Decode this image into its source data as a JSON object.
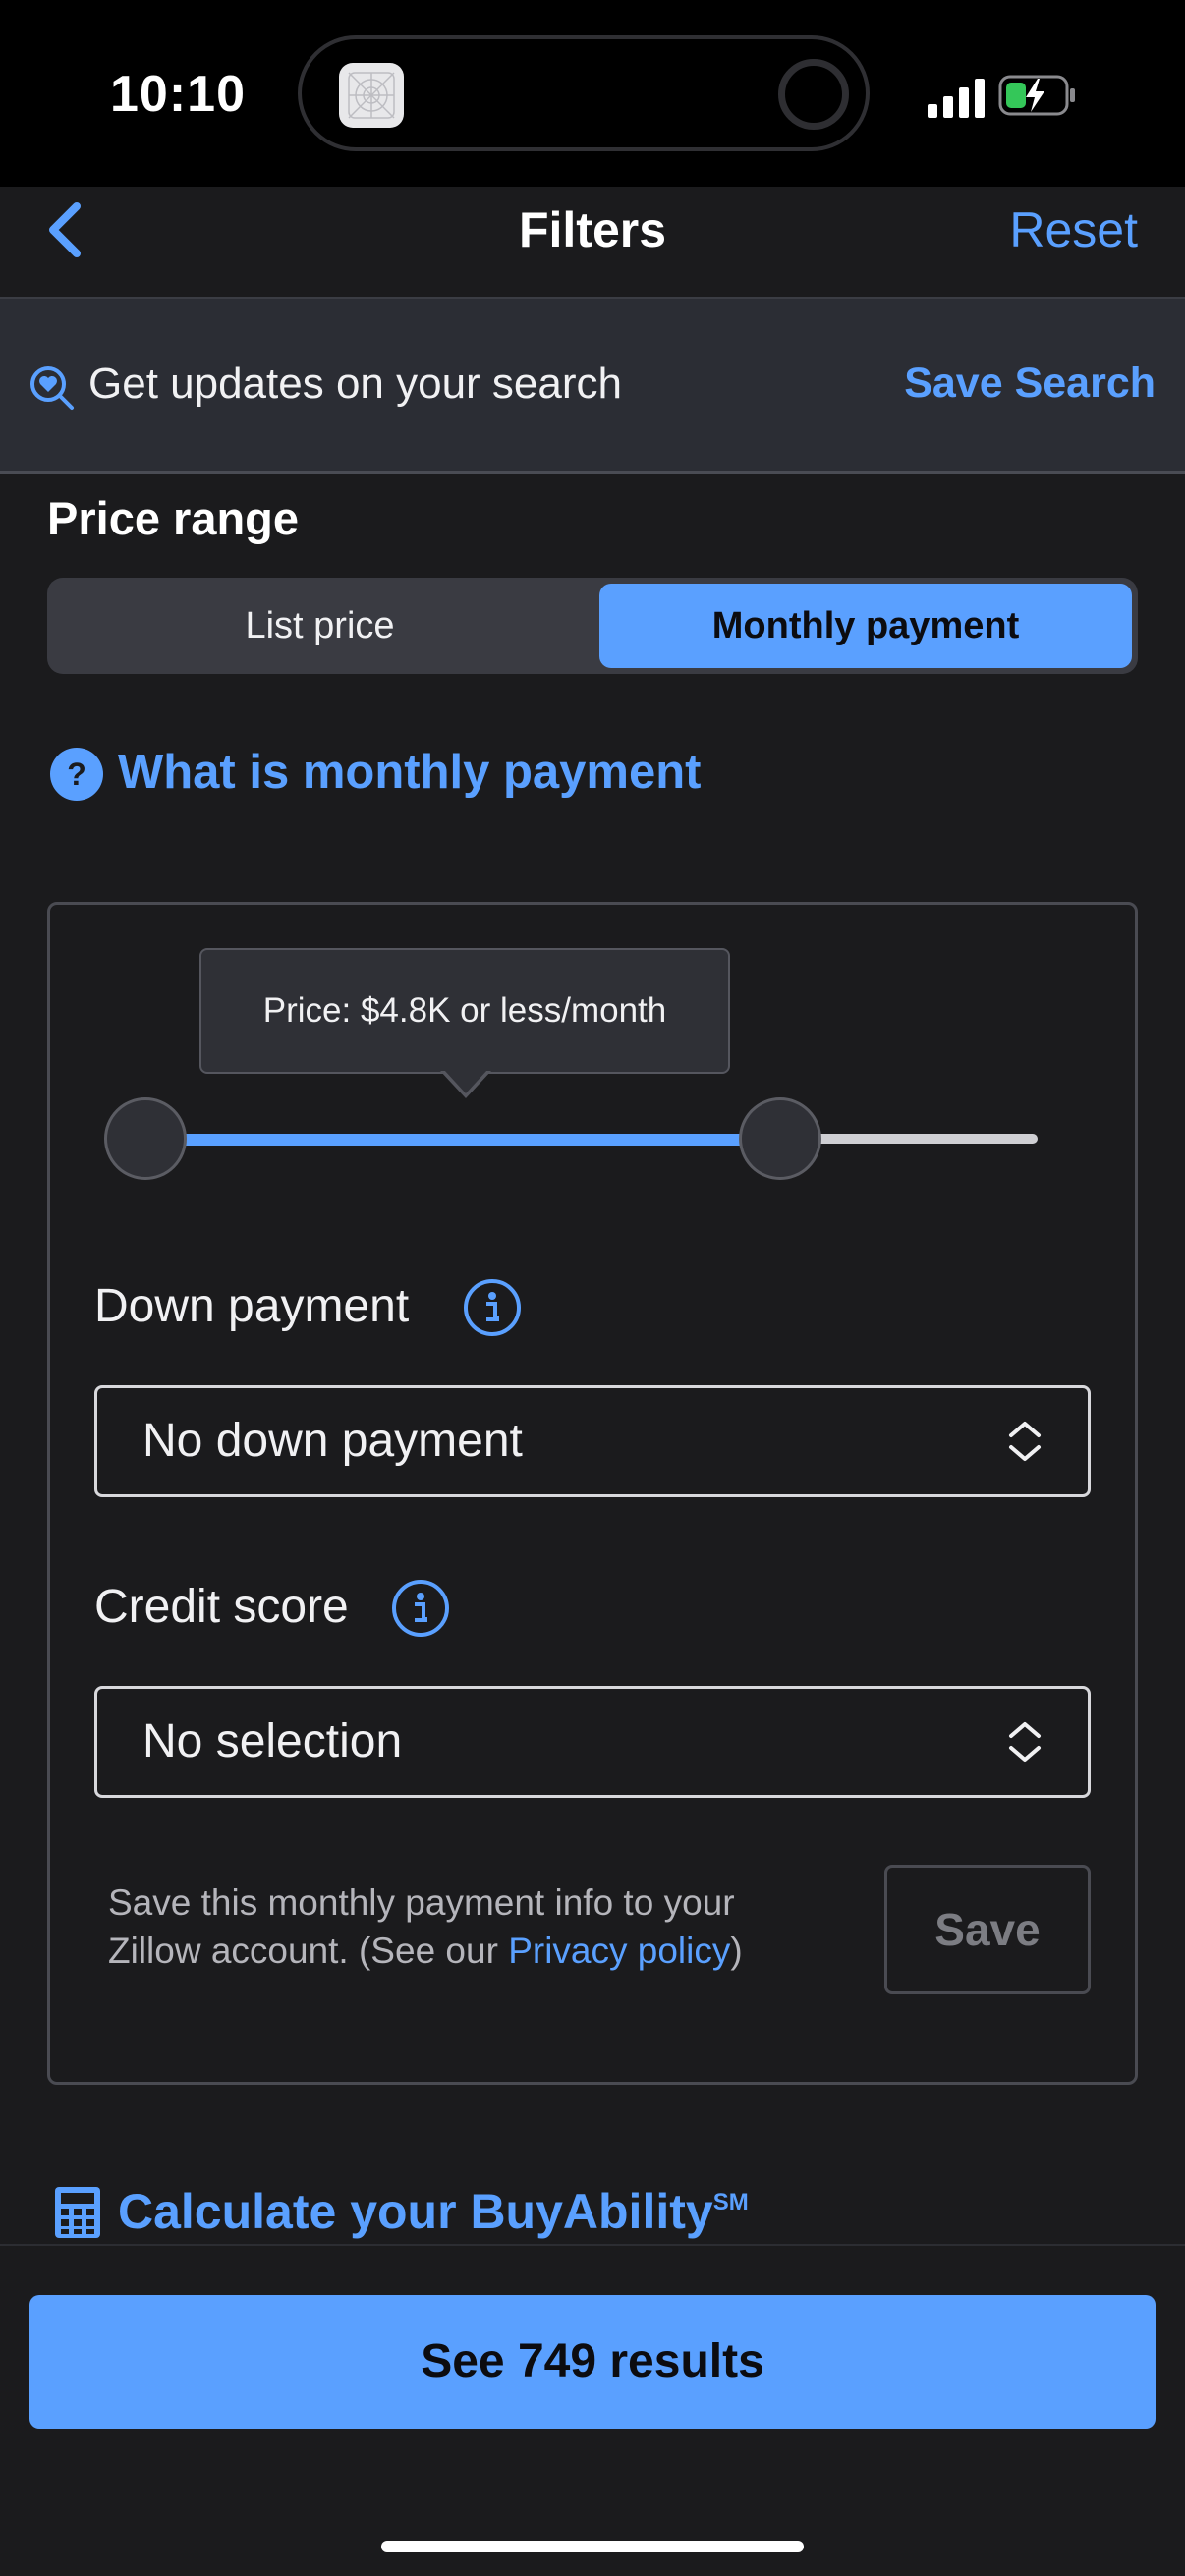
{
  "status_bar": {
    "time": "10:10"
  },
  "nav": {
    "back_icon": "chevron-left-icon",
    "title": "Filters",
    "reset_label": "Reset"
  },
  "banner": {
    "icon": "search-heart-icon",
    "text": "Get updates on your search",
    "save_label": "Save Search"
  },
  "price_range": {
    "title": "Price range",
    "tabs": [
      {
        "label": "List price",
        "selected": false
      },
      {
        "label": "Monthly payment",
        "selected": true
      }
    ],
    "help_link": "What is monthly payment",
    "slider": {
      "tooltip": "Price: $4.8K or less/month",
      "selected_fraction": 0.68
    },
    "down_payment": {
      "label": "Down payment",
      "value": "No down payment"
    },
    "credit_score": {
      "label": "Credit score",
      "value": "No selection"
    },
    "save_note": {
      "text_before": "Save this monthly payment info to your Zillow account. (See our ",
      "link": "Privacy policy",
      "text_after": ")"
    },
    "save_button": "Save"
  },
  "calculator": {
    "label": "Calculate your BuyAbility",
    "superscript": "SM"
  },
  "results_button": "See 749 results",
  "colors": {
    "accent": "#5aa0ff",
    "background": "#1b1b1d",
    "banner": "#2b2d34"
  }
}
